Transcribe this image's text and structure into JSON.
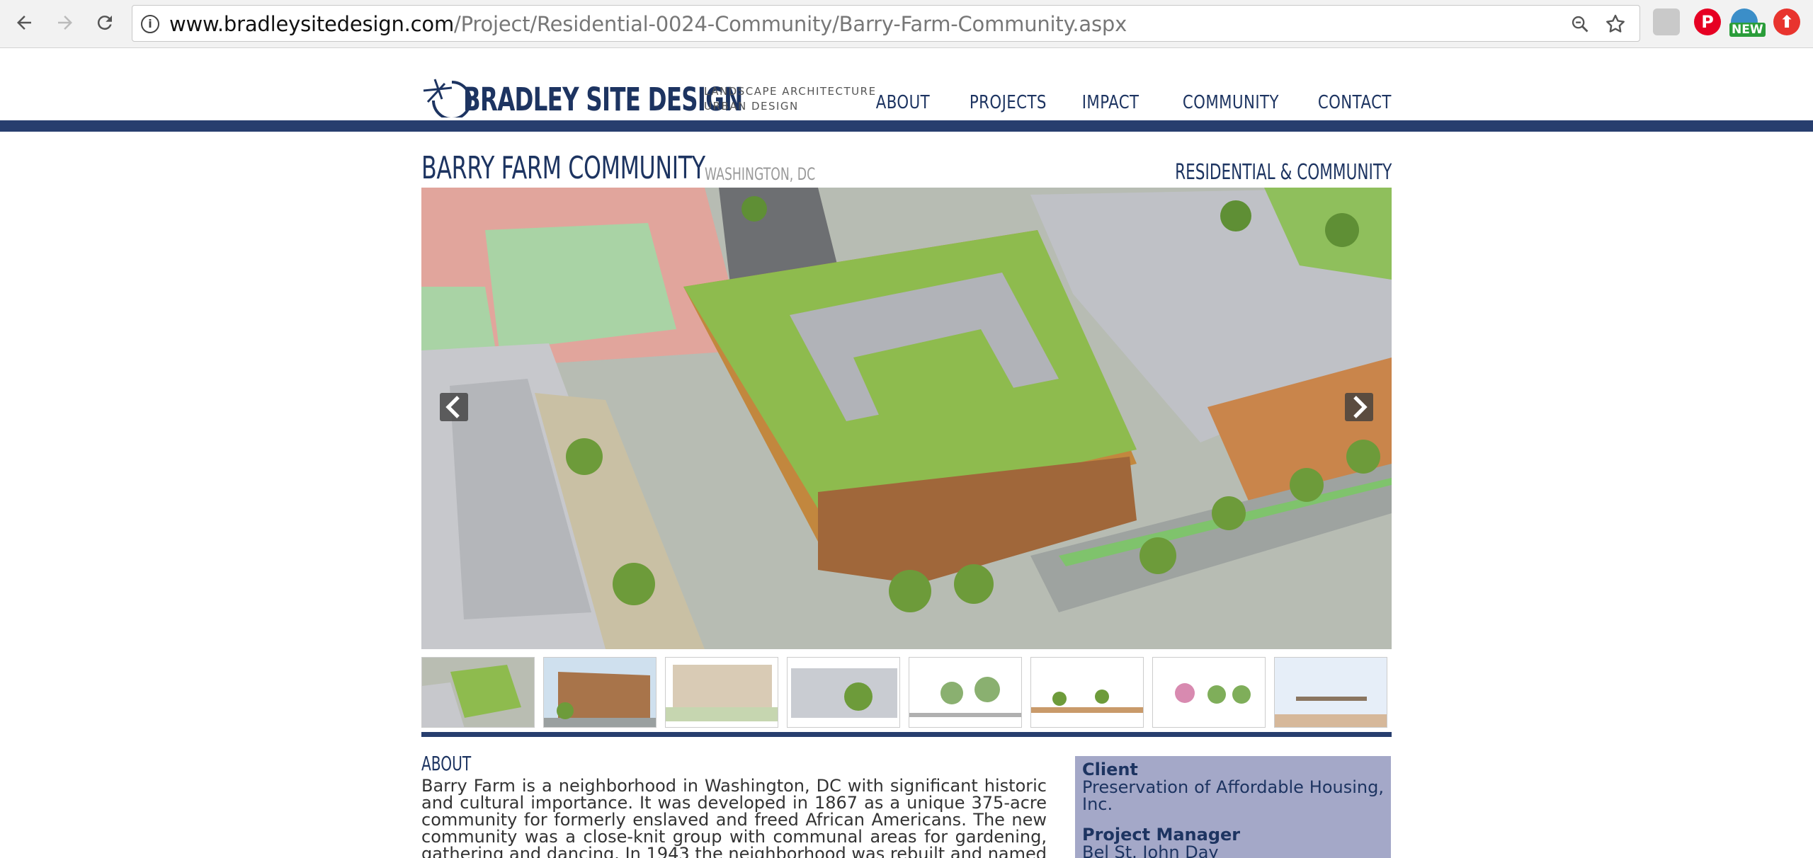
{
  "browser": {
    "url_host": "www.bradleysitedesign.com",
    "url_path": "/Project/Residential-0024-Community/Barry-Farm-Community.aspx",
    "extension_badge": "NEW"
  },
  "site": {
    "logo_name": "BRADLEY SITE DESIGN",
    "tagline_line1": "LANDSCAPE ARCHITECTURE",
    "tagline_line2": "URBAN DESIGN",
    "nav": [
      "ABOUT",
      "PROJECTS",
      "IMPACT",
      "COMMUNITY",
      "CONTACT"
    ],
    "brand_color": "#1d3461",
    "bar_color": "#273e6e"
  },
  "project": {
    "title": "BARRY FARM COMMUNITY",
    "location": "WASHINGTON, DC",
    "category": "RESIDENTIAL & COMMUNITY",
    "thumbnail_count": 8
  },
  "about": {
    "heading": "ABOUT",
    "text": "Barry Farm is a neighborhood in Washington, DC with significant historic and cultural importance. It was developed in 1867 as a unique 375-acre community for formerly enslaved and freed African Americans. The new community was a close-knit group with communal areas for gardening, gathering and dancing. In 1943 the neighborhood was rebuilt and named Barry Farm Dwellings as part"
  },
  "info": {
    "client_label": "Client",
    "client_value": "Preservation of Affordable Housing, Inc.",
    "pm_label": "Project Manager",
    "pm_value": "Bel St. John Day"
  }
}
